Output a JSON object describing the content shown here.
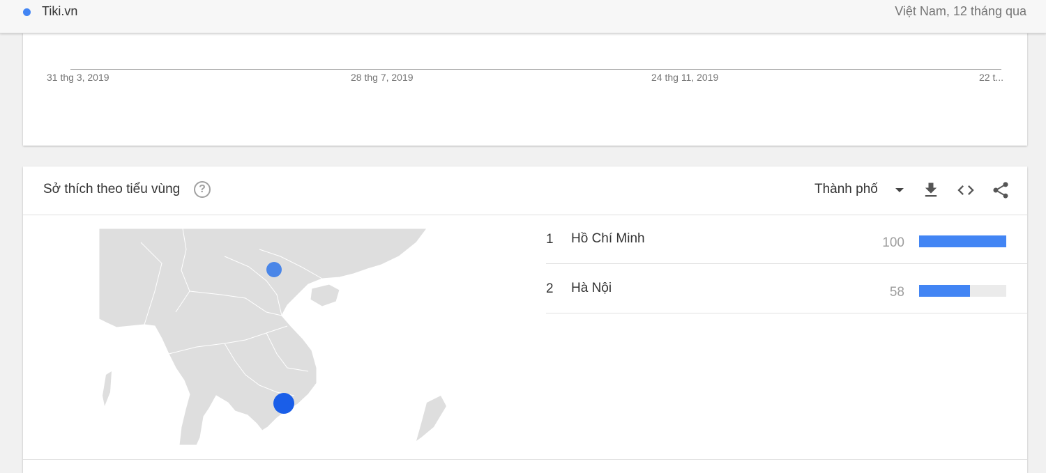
{
  "header": {
    "term": "Tiki.vn",
    "term_color": "#4285f4",
    "scope": "Việt Nam, 12 tháng qua"
  },
  "timeline": {
    "axis_ticks": [
      "31 thg 3, 2019",
      "28 thg 7, 2019",
      "24 thg 11, 2019",
      "22 t..."
    ]
  },
  "subregion": {
    "title": "Sở thích theo tiểu vùng",
    "help_icon": "help-circle-icon",
    "resolution": "Thành phố",
    "tools": [
      "download-icon",
      "embed-code-icon",
      "share-icon"
    ],
    "rows": [
      {
        "rank": "1",
        "name": "Hồ Chí Minh",
        "value": "100",
        "fraction": 1.0
      },
      {
        "rank": "2",
        "name": "Hà Nội",
        "value": "58",
        "fraction": 0.58
      }
    ],
    "map_markers": [
      {
        "city": "Hà Nội",
        "size": "small",
        "color": "#4a86e8"
      },
      {
        "city": "Hồ Chí Minh",
        "size": "large",
        "color": "#1a5ee8"
      }
    ]
  }
}
